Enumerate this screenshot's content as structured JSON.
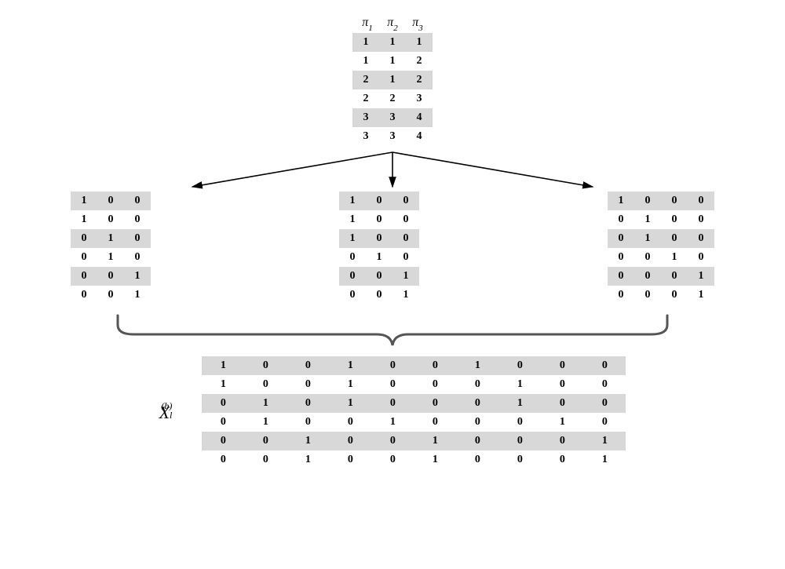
{
  "chart_data": {
    "type": "table",
    "title": "",
    "pi_header": [
      "π₁",
      "π₂",
      "π₃"
    ],
    "pi_matrix": [
      [
        1,
        1,
        1
      ],
      [
        1,
        1,
        2
      ],
      [
        2,
        1,
        2
      ],
      [
        2,
        2,
        3
      ],
      [
        3,
        3,
        4
      ],
      [
        3,
        3,
        4
      ]
    ],
    "mid_matrices": [
      {
        "cols": 3,
        "rows": [
          [
            1,
            0,
            0
          ],
          [
            1,
            0,
            0
          ],
          [
            0,
            1,
            0
          ],
          [
            0,
            1,
            0
          ],
          [
            0,
            0,
            1
          ],
          [
            0,
            0,
            1
          ]
        ]
      },
      {
        "cols": 3,
        "rows": [
          [
            1,
            0,
            0
          ],
          [
            1,
            0,
            0
          ],
          [
            1,
            0,
            0
          ],
          [
            0,
            1,
            0
          ],
          [
            0,
            0,
            1
          ],
          [
            0,
            0,
            1
          ]
        ]
      },
      {
        "cols": 4,
        "rows": [
          [
            1,
            0,
            0,
            0
          ],
          [
            0,
            1,
            0,
            0
          ],
          [
            0,
            1,
            0,
            0
          ],
          [
            0,
            0,
            1,
            0
          ],
          [
            0,
            0,
            0,
            1
          ],
          [
            0,
            0,
            0,
            1
          ]
        ]
      }
    ],
    "bottom_matrix": {
      "cols": 10,
      "rows": [
        [
          1,
          0,
          0,
          1,
          0,
          0,
          1,
          0,
          0,
          0
        ],
        [
          1,
          0,
          0,
          1,
          0,
          0,
          0,
          1,
          0,
          0
        ],
        [
          0,
          1,
          0,
          1,
          0,
          0,
          0,
          1,
          0,
          0
        ],
        [
          0,
          1,
          0,
          0,
          1,
          0,
          0,
          0,
          1,
          0
        ],
        [
          0,
          0,
          1,
          0,
          0,
          1,
          0,
          0,
          0,
          1
        ],
        [
          0,
          0,
          1,
          0,
          0,
          1,
          0,
          0,
          0,
          1
        ]
      ]
    },
    "bottom_label": {
      "base": "X",
      "sub": "l",
      "sup": "(b)"
    }
  }
}
